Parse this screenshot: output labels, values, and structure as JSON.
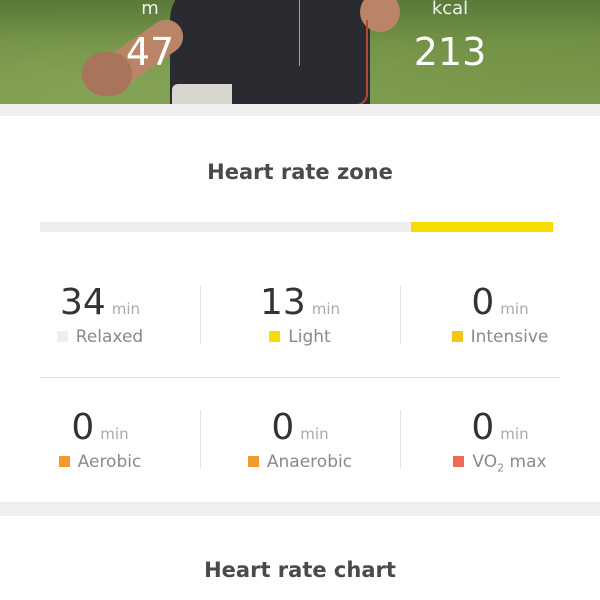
{
  "hero": {
    "left_stat": {
      "unit": "m",
      "value": "47"
    },
    "right_stat": {
      "unit": "kcal",
      "value": "213"
    }
  },
  "heart_rate_zone": {
    "title": "Heart rate zone",
    "bar_segments": [
      {
        "zone": "Relaxed",
        "fraction": 0.723,
        "color": "#eeeeee"
      },
      {
        "zone": "Light",
        "fraction": 0.277,
        "color": "#f7dc00"
      }
    ],
    "zones": [
      {
        "value": "34",
        "unit": "min",
        "label": "Relaxed",
        "color": "#eeeeee"
      },
      {
        "value": "13",
        "unit": "min",
        "label": "Light",
        "color": "#f7dc00"
      },
      {
        "value": "0",
        "unit": "min",
        "label": "Intensive",
        "color": "#f5c518"
      },
      {
        "value": "0",
        "unit": "min",
        "label": "Aerobic",
        "color": "#f29a2e"
      },
      {
        "value": "0",
        "unit": "min",
        "label": "Anaerobic",
        "color": "#f29a2e"
      },
      {
        "value": "0",
        "unit": "min",
        "label_main": "VO",
        "label_sub": "2",
        "label_tail": " max",
        "color": "#ee6a5a"
      }
    ]
  },
  "heart_rate_chart": {
    "title": "Heart rate chart"
  }
}
